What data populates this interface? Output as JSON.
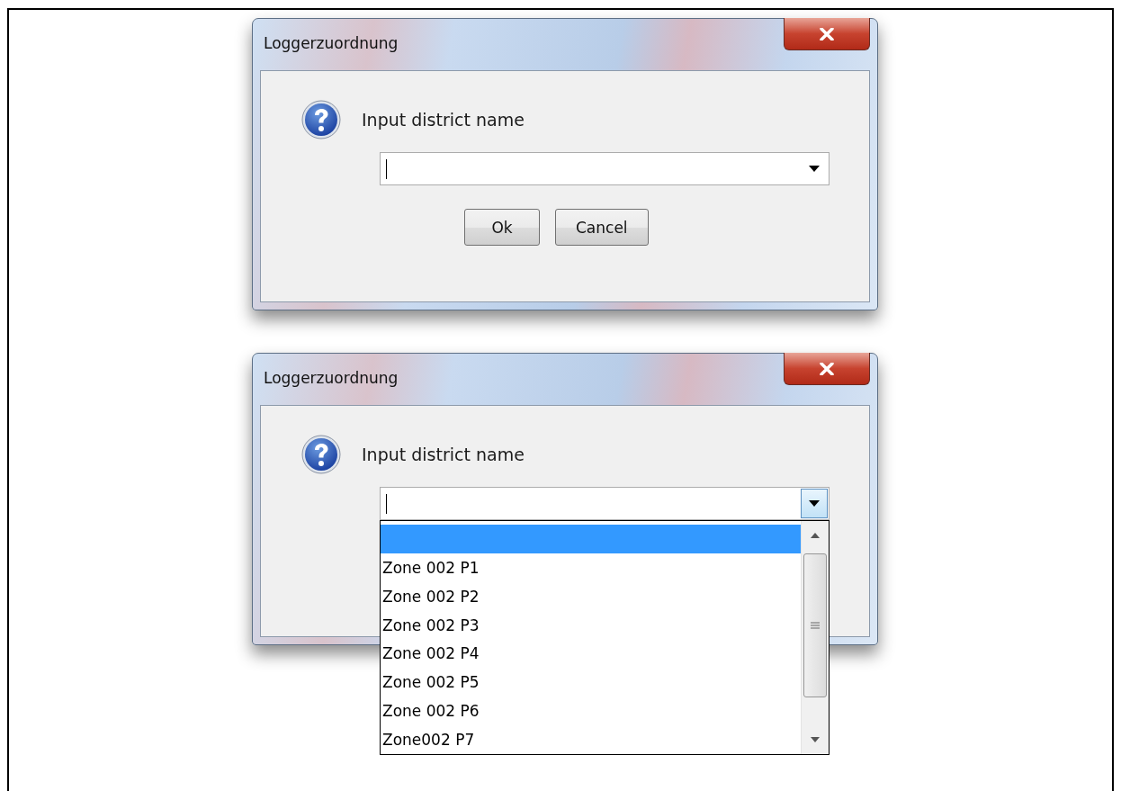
{
  "dialogs": [
    {
      "title": "Loggerzuordnung",
      "prompt": "Input district name",
      "combo_open": false,
      "buttons": [
        "Ok",
        "Cancel"
      ]
    },
    {
      "title": "Loggerzuordnung",
      "prompt": "Input district name",
      "combo_open": true,
      "options": [
        {
          "selected": true
        },
        {
          "label": "Zone 002 P1",
          "selected": false
        },
        {
          "label": "Zone 002 P2",
          "selected": false
        },
        {
          "label": "Zone 002 P3",
          "selected": false
        },
        {
          "label": "Zone 002 P4",
          "selected": false
        },
        {
          "label": "Zone 002 P5",
          "selected": false
        },
        {
          "label": "Zone 002 P6",
          "selected": false
        },
        {
          "label": "Zone002 P7",
          "selected": false
        }
      ]
    }
  ]
}
